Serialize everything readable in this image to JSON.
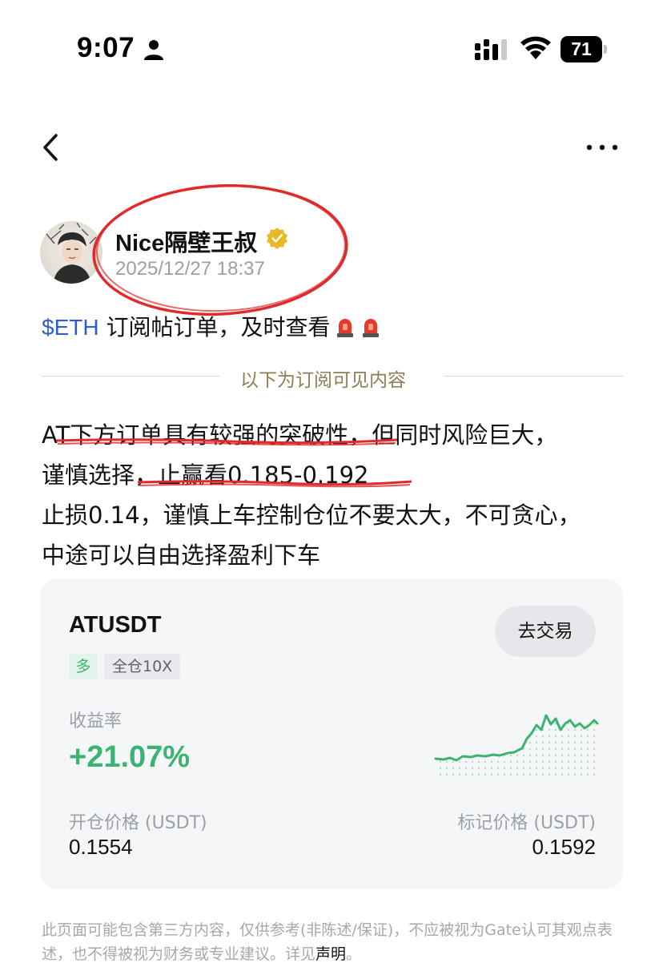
{
  "status_bar": {
    "time": "9:07",
    "battery": "71",
    "icons": [
      "person-icon",
      "signal-icon",
      "wifi-icon",
      "battery-icon"
    ]
  },
  "nav": {
    "icons": [
      "back-icon",
      "more-icon"
    ]
  },
  "author": {
    "name": "Nice隔壁王叔",
    "timestamp": "2025/12/27 18:37",
    "verified_color": "#e8b923"
  },
  "post": {
    "ticker": "$ETH",
    "headline": " 订阅帖订单，及时查看",
    "subscriber_divider": "以下为订阅可见内容",
    "body_lines": [
      "AT下方订单具有较强的突破性，但同时风险巨大，",
      "谨慎选择，止赢看0.185-0.192",
      "止损0.14，谨慎上车控制仓位不要太大，不可贪心，",
      "中途可以自由选择盈利下车"
    ]
  },
  "card": {
    "symbol": "ATUSDT",
    "trade_button": "去交易",
    "side_tag": "多",
    "margin_tag": "全仓10X",
    "roi_label": "收益率",
    "roi_value": "+21.07%",
    "open_price_label": "开仓价格 (USDT)",
    "open_price": "0.1554",
    "mark_price_label": "标记价格 (USDT)",
    "mark_price": "0.1592",
    "accent_color": "#3cb371"
  },
  "disclaimer": {
    "text": "此页面可能包含第三方内容，仅供参考(非陈述/保证)，不应被视为Gate认可其观点表述，也不得被视为财务或专业建议。详见",
    "link": "声明",
    "end": "。"
  }
}
